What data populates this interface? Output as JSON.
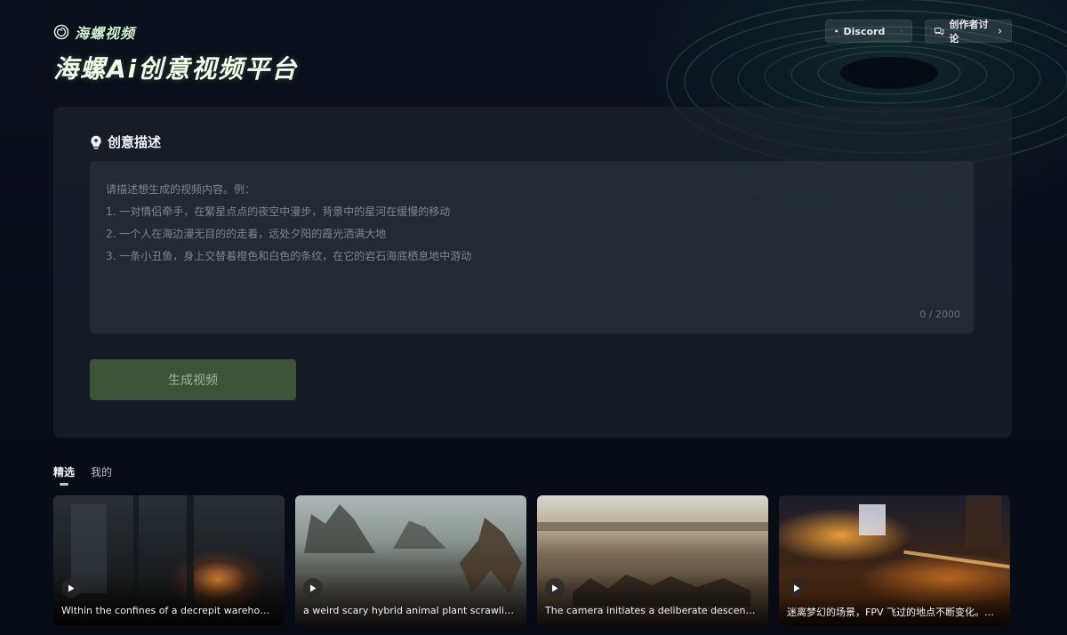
{
  "brand": {
    "name": "海螺视频",
    "hero_title": "海螺Ai创意视频平台"
  },
  "top_actions": {
    "discord_label": "Discord",
    "forum_label": "创作者讨论"
  },
  "prompt_panel": {
    "heading": "创意描述",
    "placeholder": "请描述想生成的视频内容。例：\n1. 一对情侣牵手，在繁星点点的夜空中漫步，背景中的星河在缓慢的移动\n2. 一个人在海边漫无目的的走着，远处夕阳的霞光洒满大地\n3. 一条小丑鱼，身上交替着橙色和白色的条纹，在它的岩石海底栖息地中游动",
    "counter": "0 / 2000",
    "generate_label": "生成视频"
  },
  "tabs": [
    {
      "label": "精选",
      "active": true
    },
    {
      "label": "我的",
      "active": false
    }
  ],
  "cards": [
    {
      "caption": "Within the confines of a decrepit warehouse, the camera sweeps across the scene"
    },
    {
      "caption": "a weird scary hybrid animal plant scrawling in the ruins"
    },
    {
      "caption": "The camera initiates a deliberate descent from above the battlefield"
    },
    {
      "caption": "迷离梦幻的场景，FPV 飞过的地点不断变化。夜晚的城市"
    }
  ],
  "colors": {
    "accent": "#a8d99a",
    "generate_bg": "#3d5338",
    "panel_bg": "#1c222c"
  }
}
